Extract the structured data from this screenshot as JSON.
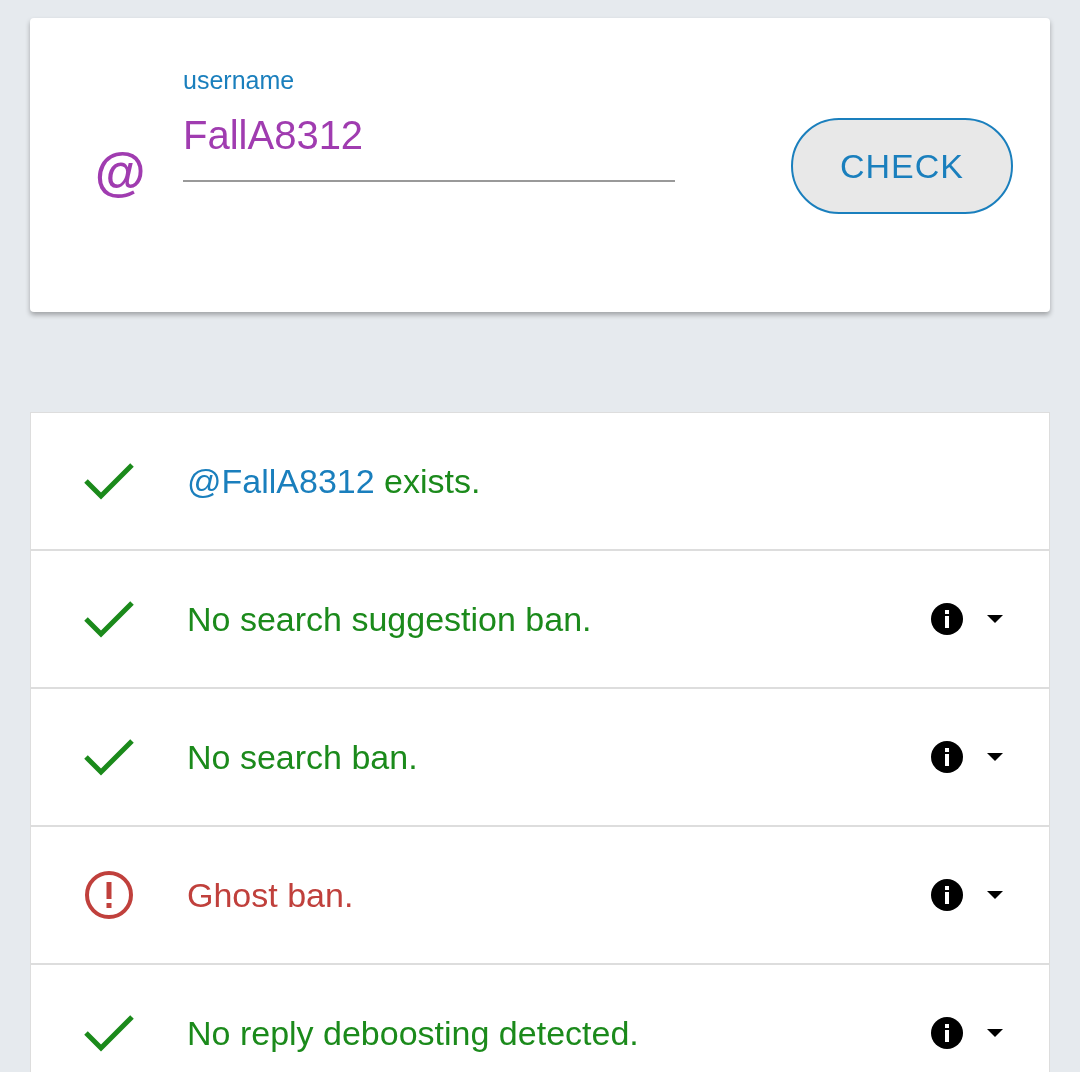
{
  "username_field": {
    "label": "username",
    "value": "FallA8312",
    "prefix": "@"
  },
  "check_button": {
    "label": "CHECK"
  },
  "results": [
    {
      "kind": "ok",
      "handle": "@FallA8312",
      "text": " exists.",
      "expandable": false
    },
    {
      "kind": "ok",
      "text": "No search suggestion ban.",
      "expandable": true
    },
    {
      "kind": "ok",
      "text": "No search ban.",
      "expandable": true
    },
    {
      "kind": "ban",
      "text": "Ghost ban.",
      "expandable": true
    },
    {
      "kind": "ok",
      "text": "No reply deboosting detected.",
      "expandable": true
    }
  ]
}
